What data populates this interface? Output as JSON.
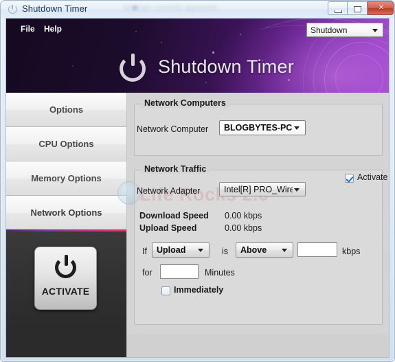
{
  "window": {
    "title": "Shutdown Timer",
    "title_icon": "power-icon",
    "ghost_text": "Set logs: commits appeared",
    "controls": {
      "minimize": "minimize-icon",
      "maximize": "maximize-icon",
      "close": "×"
    }
  },
  "menu": {
    "file": "File",
    "help": "Help"
  },
  "banner": {
    "logo_icon": "power-icon",
    "logo_text": "Shutdown Timer",
    "mode_select": {
      "value": "Shutdown",
      "icon": "chevron-down-icon"
    }
  },
  "sidebar": {
    "tabs": [
      {
        "label": "Options"
      },
      {
        "label": "CPU Options"
      },
      {
        "label": "Memory Options"
      },
      {
        "label": "Network Options"
      }
    ],
    "activate_button": {
      "label": "ACTIVATE",
      "icon": "power-icon"
    }
  },
  "watermark": "Life Rocks 2.0",
  "content": {
    "network_computers": {
      "title": "Network Computers",
      "computer_label": "Network Computer",
      "computer_value": "BLOGBYTES-PC"
    },
    "network_traffic": {
      "title": "Network Traffic",
      "activate_label": "Activate",
      "activate_checked": true,
      "adapter_label": "Network Adapter",
      "adapter_value": "Intel[R] PRO_Wireless",
      "download_label": "Download Speed",
      "download_value": "0.00 kbps",
      "upload_label": "Upload Speed",
      "upload_value": "0.00 kbps",
      "rule": {
        "if_label": "If",
        "metric_value": "Upload",
        "is_label": "is",
        "compare_value": "Above",
        "threshold_value": "",
        "unit_label": "kbps",
        "for_label": "for",
        "minutes_value": "",
        "minutes_label": "Minutes"
      },
      "immediately_label": "Immediately",
      "immediately_checked": false
    }
  },
  "colors": {
    "banner_dark": "#150a20",
    "banner_light": "#a249cf",
    "divider_start": "#4b2a6e",
    "divider_end": "#e8326c",
    "panel_bg": "#d4d4d4",
    "sidebar_dark": "#2a2a2a",
    "close_button": "#b93a26"
  }
}
